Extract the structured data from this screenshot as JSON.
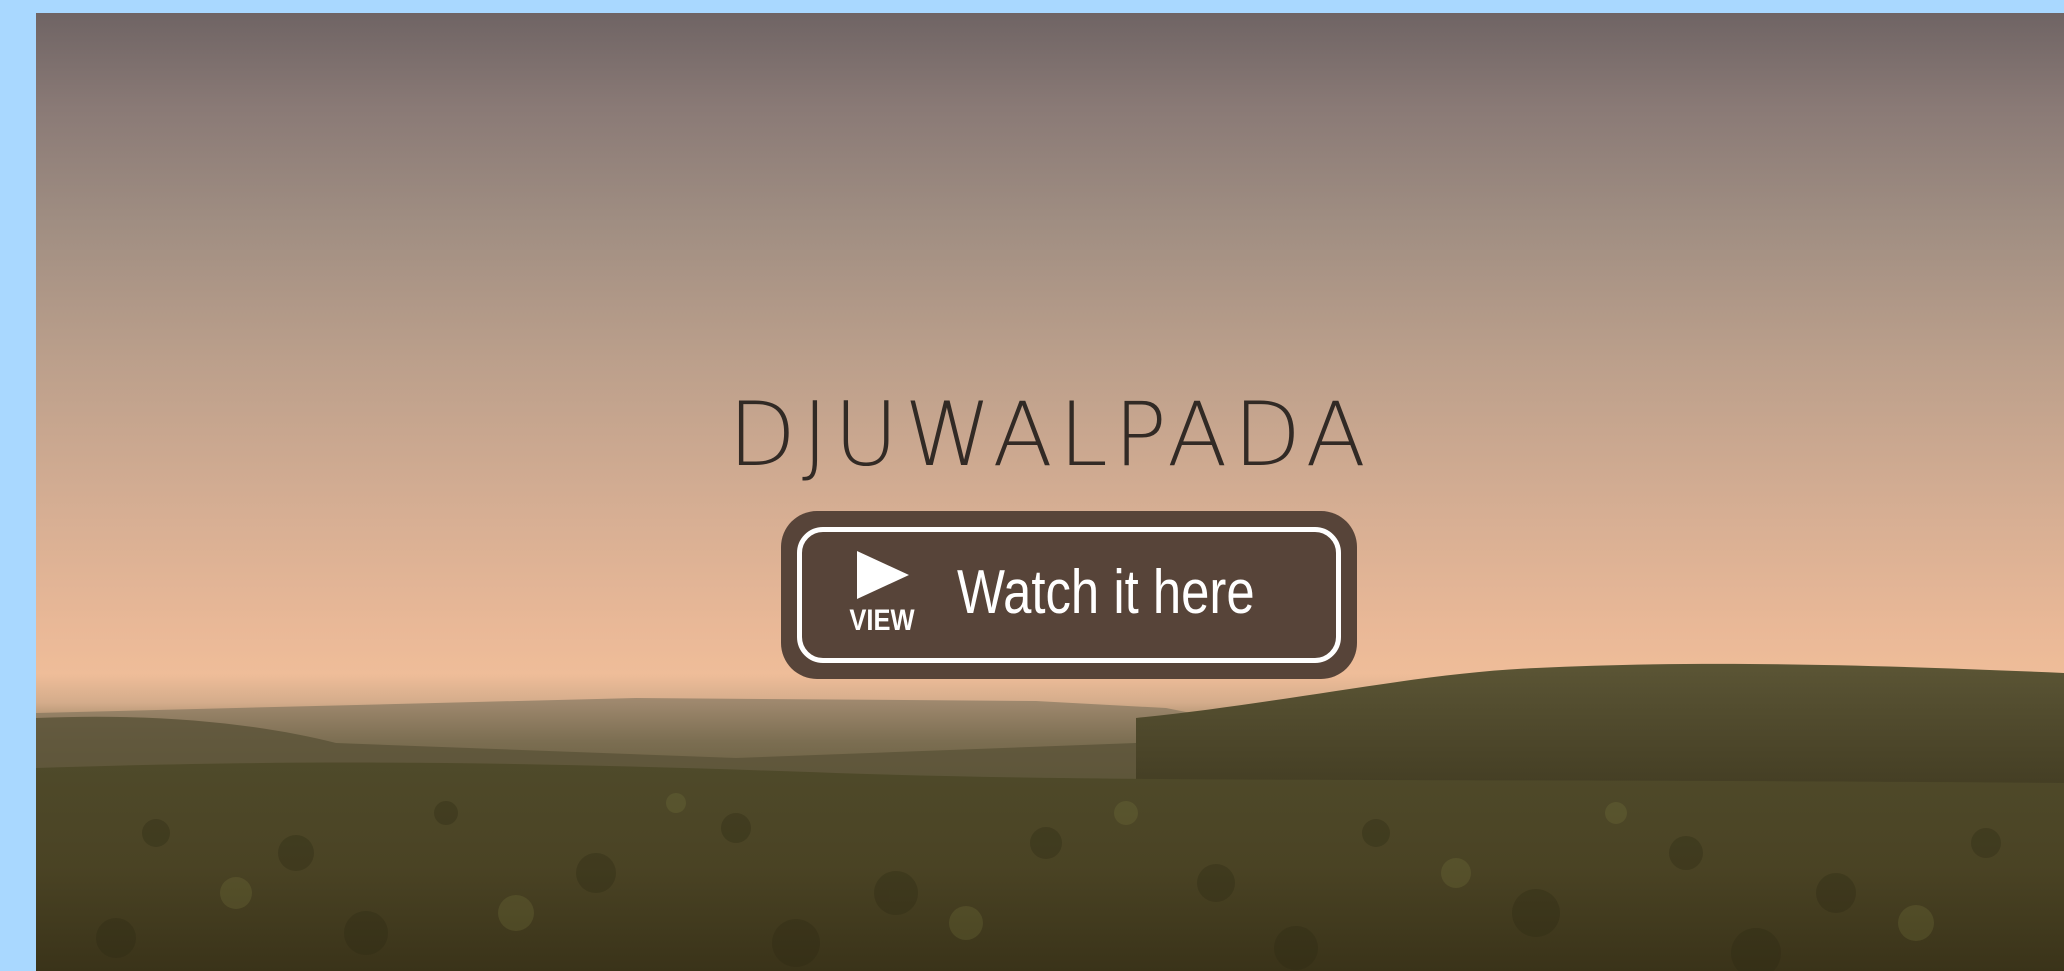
{
  "video": {
    "title": "DJUWALPADA",
    "watch_button": {
      "badge_label": "VIEW",
      "label": "Watch it here",
      "play_icon": "play-triangle-icon"
    }
  },
  "colors": {
    "page_background": "#a9d8ff",
    "button_background": "#574439",
    "button_border": "#ffffff",
    "title_text": "#2a2420"
  }
}
